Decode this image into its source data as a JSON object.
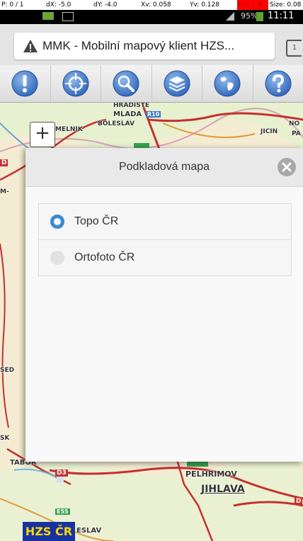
{
  "debug": {
    "pointer": "P: 0 / 1",
    "dx": "dX: -5.0",
    "dy": "dY: -4.0",
    "xv": "Xv: 0.058",
    "yv": "Yv: 0.128",
    "prs": "Prs: 1.0",
    "size": "Size: 0.08"
  },
  "status": {
    "battery_text": "95%",
    "time": "11:11",
    "colors": {
      "battery": "#5fa42a"
    }
  },
  "browser": {
    "page_title": "MMK - Mobilní mapový klient HZS...",
    "tab_count": "1",
    "warning_icon": "warning-icon"
  },
  "toolbar": {
    "tools": [
      {
        "name": "info",
        "icon": "exclamation-icon"
      },
      {
        "name": "locate",
        "icon": "crosshair-icon"
      },
      {
        "name": "search",
        "icon": "magnifier-icon"
      },
      {
        "name": "layers",
        "icon": "layers-icon"
      },
      {
        "name": "globe",
        "icon": "globe-icon"
      },
      {
        "name": "help",
        "icon": "question-icon"
      }
    ]
  },
  "map": {
    "zoom_in": "+",
    "labels": {
      "hradiste": "HRADISTE",
      "mlada": "MLADA",
      "boleslav": "BOLESLAV",
      "melnik": "MELNIK",
      "r10": "R10",
      "jicin": "JICIN",
      "no": "NO",
      "pa": "PA",
      "tabor": "TABOR",
      "d3": "D3",
      "pelhrimov": "PELHRIMOV",
      "jihlava": "JIHLAVA",
      "e55": "E55",
      "eslav": "ESLAV",
      "d": "D",
      "m": "M-",
      "sed": "SED",
      "sk": "SK"
    },
    "brand_badge": "HZS ČR"
  },
  "dialog": {
    "title": "Podkladová mapa",
    "options": [
      {
        "label": "Topo ČR",
        "selected": true
      },
      {
        "label": "Ortofoto ČR",
        "selected": false
      }
    ],
    "colors": {
      "radio_active": "#3a8ad6"
    }
  }
}
